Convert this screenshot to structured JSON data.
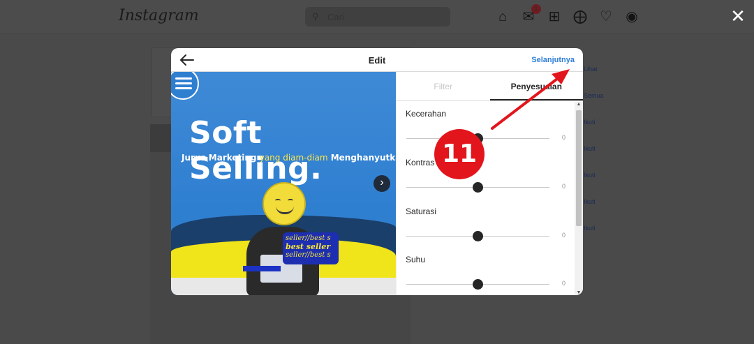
{
  "background": {
    "logo": "Instagram",
    "search_placeholder": "Cari",
    "notification_count": "1",
    "side_links": [
      "Lihat",
      "Semua",
      "Ikuti",
      "Ikuti",
      "Ikuti",
      "Ikuti",
      "Ikuti"
    ]
  },
  "modal": {
    "title": "Edit",
    "next_label": "Selanjutnya",
    "back_icon": "arrow-left-icon"
  },
  "image": {
    "headline": "Soft Selling.",
    "sub_bold_1": "Jurus Marketing",
    "sub_light": "yang diam-diam",
    "sub_bold_2": "Menghanyutkan",
    "bubble_lines": [
      "seller//best s",
      "best seller",
      "seller//best s"
    ],
    "carousel_dots": 2,
    "active_dot": 0
  },
  "panel": {
    "tabs": [
      {
        "label": "Filter",
        "active": false
      },
      {
        "label": "Penyesuaian",
        "active": true
      }
    ],
    "adjustments": [
      {
        "label": "Kecerahan",
        "value": "0",
        "level": 0.5
      },
      {
        "label": "Kontras",
        "value": "0",
        "level": 0.5
      },
      {
        "label": "Saturasi",
        "value": "0",
        "level": 0.5
      },
      {
        "label": "Suhu",
        "value": "0",
        "level": 0.5
      }
    ]
  },
  "annotation": {
    "step_number": "11",
    "color": "#e3151c"
  },
  "close_icon": "close-icon"
}
